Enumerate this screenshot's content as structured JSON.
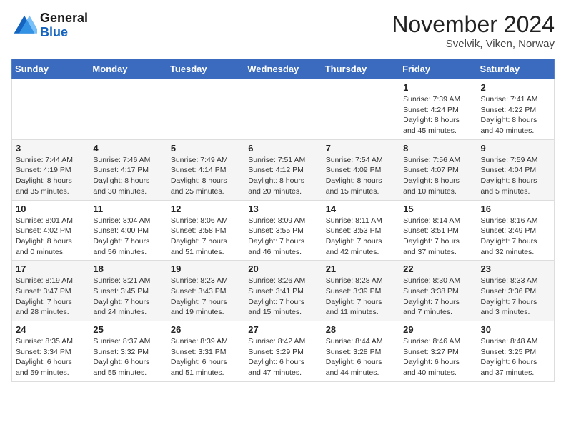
{
  "header": {
    "logo_line1": "General",
    "logo_line2": "Blue",
    "month_title": "November 2024",
    "location": "Svelvik, Viken, Norway"
  },
  "days_of_week": [
    "Sunday",
    "Monday",
    "Tuesday",
    "Wednesday",
    "Thursday",
    "Friday",
    "Saturday"
  ],
  "weeks": [
    [
      {
        "day": "",
        "info": ""
      },
      {
        "day": "",
        "info": ""
      },
      {
        "day": "",
        "info": ""
      },
      {
        "day": "",
        "info": ""
      },
      {
        "day": "",
        "info": ""
      },
      {
        "day": "1",
        "info": "Sunrise: 7:39 AM\nSunset: 4:24 PM\nDaylight: 8 hours and 45 minutes."
      },
      {
        "day": "2",
        "info": "Sunrise: 7:41 AM\nSunset: 4:22 PM\nDaylight: 8 hours and 40 minutes."
      }
    ],
    [
      {
        "day": "3",
        "info": "Sunrise: 7:44 AM\nSunset: 4:19 PM\nDaylight: 8 hours and 35 minutes."
      },
      {
        "day": "4",
        "info": "Sunrise: 7:46 AM\nSunset: 4:17 PM\nDaylight: 8 hours and 30 minutes."
      },
      {
        "day": "5",
        "info": "Sunrise: 7:49 AM\nSunset: 4:14 PM\nDaylight: 8 hours and 25 minutes."
      },
      {
        "day": "6",
        "info": "Sunrise: 7:51 AM\nSunset: 4:12 PM\nDaylight: 8 hours and 20 minutes."
      },
      {
        "day": "7",
        "info": "Sunrise: 7:54 AM\nSunset: 4:09 PM\nDaylight: 8 hours and 15 minutes."
      },
      {
        "day": "8",
        "info": "Sunrise: 7:56 AM\nSunset: 4:07 PM\nDaylight: 8 hours and 10 minutes."
      },
      {
        "day": "9",
        "info": "Sunrise: 7:59 AM\nSunset: 4:04 PM\nDaylight: 8 hours and 5 minutes."
      }
    ],
    [
      {
        "day": "10",
        "info": "Sunrise: 8:01 AM\nSunset: 4:02 PM\nDaylight: 8 hours and 0 minutes."
      },
      {
        "day": "11",
        "info": "Sunrise: 8:04 AM\nSunset: 4:00 PM\nDaylight: 7 hours and 56 minutes."
      },
      {
        "day": "12",
        "info": "Sunrise: 8:06 AM\nSunset: 3:58 PM\nDaylight: 7 hours and 51 minutes."
      },
      {
        "day": "13",
        "info": "Sunrise: 8:09 AM\nSunset: 3:55 PM\nDaylight: 7 hours and 46 minutes."
      },
      {
        "day": "14",
        "info": "Sunrise: 8:11 AM\nSunset: 3:53 PM\nDaylight: 7 hours and 42 minutes."
      },
      {
        "day": "15",
        "info": "Sunrise: 8:14 AM\nSunset: 3:51 PM\nDaylight: 7 hours and 37 minutes."
      },
      {
        "day": "16",
        "info": "Sunrise: 8:16 AM\nSunset: 3:49 PM\nDaylight: 7 hours and 32 minutes."
      }
    ],
    [
      {
        "day": "17",
        "info": "Sunrise: 8:19 AM\nSunset: 3:47 PM\nDaylight: 7 hours and 28 minutes."
      },
      {
        "day": "18",
        "info": "Sunrise: 8:21 AM\nSunset: 3:45 PM\nDaylight: 7 hours and 24 minutes."
      },
      {
        "day": "19",
        "info": "Sunrise: 8:23 AM\nSunset: 3:43 PM\nDaylight: 7 hours and 19 minutes."
      },
      {
        "day": "20",
        "info": "Sunrise: 8:26 AM\nSunset: 3:41 PM\nDaylight: 7 hours and 15 minutes."
      },
      {
        "day": "21",
        "info": "Sunrise: 8:28 AM\nSunset: 3:39 PM\nDaylight: 7 hours and 11 minutes."
      },
      {
        "day": "22",
        "info": "Sunrise: 8:30 AM\nSunset: 3:38 PM\nDaylight: 7 hours and 7 minutes."
      },
      {
        "day": "23",
        "info": "Sunrise: 8:33 AM\nSunset: 3:36 PM\nDaylight: 7 hours and 3 minutes."
      }
    ],
    [
      {
        "day": "24",
        "info": "Sunrise: 8:35 AM\nSunset: 3:34 PM\nDaylight: 6 hours and 59 minutes."
      },
      {
        "day": "25",
        "info": "Sunrise: 8:37 AM\nSunset: 3:32 PM\nDaylight: 6 hours and 55 minutes."
      },
      {
        "day": "26",
        "info": "Sunrise: 8:39 AM\nSunset: 3:31 PM\nDaylight: 6 hours and 51 minutes."
      },
      {
        "day": "27",
        "info": "Sunrise: 8:42 AM\nSunset: 3:29 PM\nDaylight: 6 hours and 47 minutes."
      },
      {
        "day": "28",
        "info": "Sunrise: 8:44 AM\nSunset: 3:28 PM\nDaylight: 6 hours and 44 minutes."
      },
      {
        "day": "29",
        "info": "Sunrise: 8:46 AM\nSunset: 3:27 PM\nDaylight: 6 hours and 40 minutes."
      },
      {
        "day": "30",
        "info": "Sunrise: 8:48 AM\nSunset: 3:25 PM\nDaylight: 6 hours and 37 minutes."
      }
    ]
  ]
}
